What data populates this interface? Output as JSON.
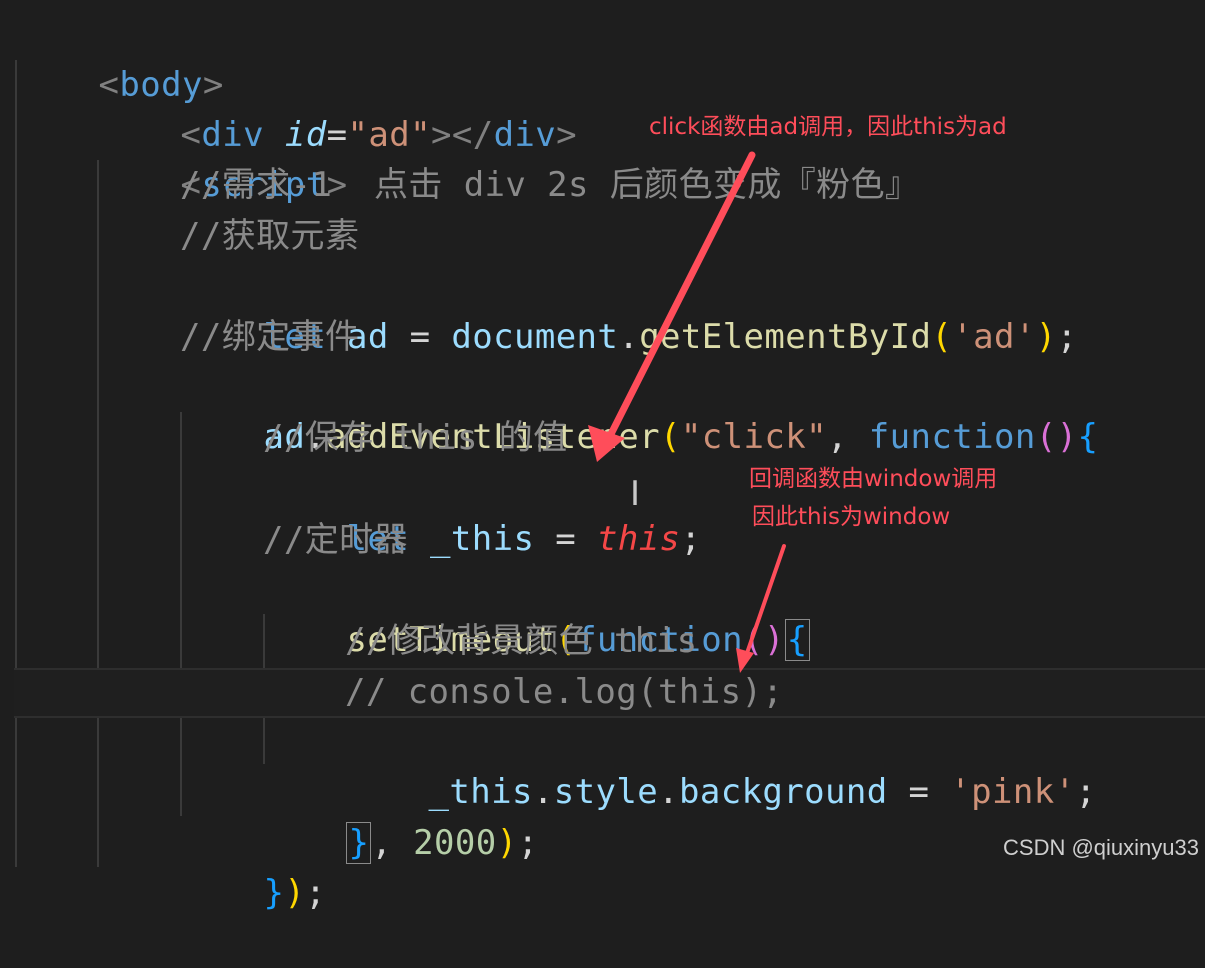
{
  "code_lines": [
    "<body>",
    "<div id=\"ad\"></div>",
    "<script>",
    "//需求-1  点击 div 2s 后颜色变成『粉色』",
    "//获取元素",
    "let ad = document.getElementById('ad');",
    "//绑定事件",
    "ad.addEventListener(\"click\", function(){",
    "//保存 this 的值",
    "let _this = this;",
    "//定时器",
    "setTimeout(function(){",
    "//修改背景颜色 this",
    "// console.log(this);",
    "_this.style.background = 'pink';",
    "}, 2000);",
    "});"
  ],
  "tokens": {
    "body": "body",
    "div": "div",
    "id": "id",
    "ad_str": "\"ad\"",
    "script": "script",
    "let": "let",
    "ad": "ad",
    "document": "document",
    "getElementById": "getElementById",
    "ad_sq": "'ad'",
    "addEventListener": "addEventListener",
    "click_str": "\"click\"",
    "function": "function",
    "_this": "_this",
    "this": "this",
    "setTimeout": "setTimeout",
    "style": "style",
    "background": "background",
    "pink_str": "'pink'",
    "num_2000": "2000"
  },
  "annotations": {
    "note1": "click函数由ad调用，因此this为ad",
    "note2_line1": "回调函数由window调用",
    "note2_line2": "因此this为window"
  },
  "watermark": "CSDN @qiuxinyu33",
  "colors": {
    "background": "#1e1e1e",
    "annotation": "#ff4d5a",
    "keyword": "#569cd6",
    "string": "#ce9178",
    "comment": "#8a8a8a",
    "variable": "#9cdcfe",
    "function": "#dcdcaa",
    "number": "#b5cea8"
  }
}
